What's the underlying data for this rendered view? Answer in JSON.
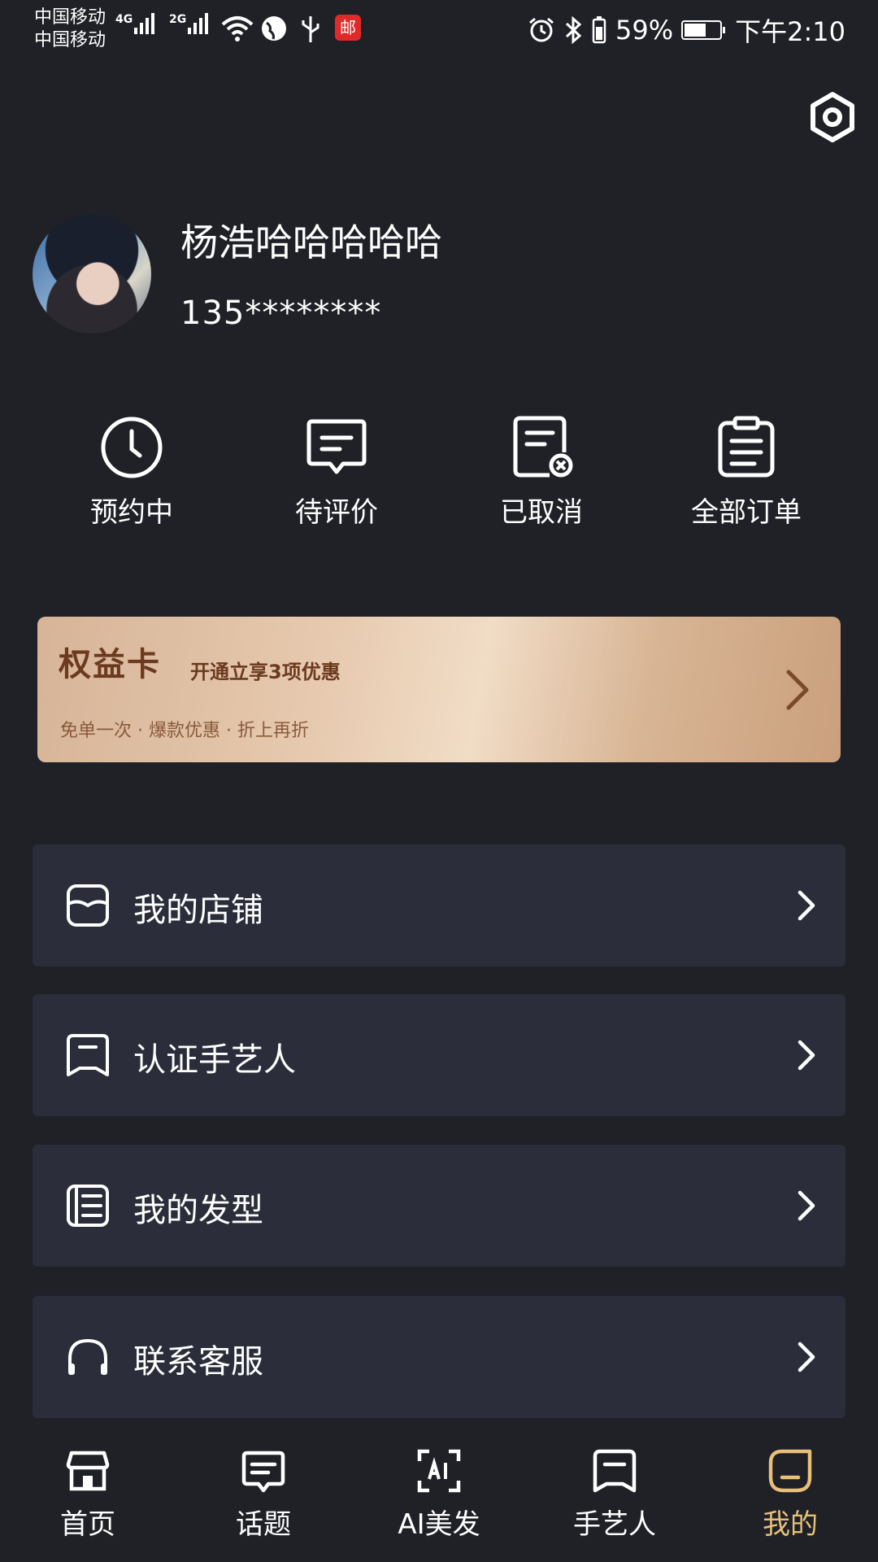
{
  "status_bar": {
    "carrier_1": "中国移动",
    "carrier_2": "中国移动",
    "network_1": "4G",
    "network_2": "2G",
    "battery_percent": "59%",
    "time": "下午2:10",
    "app_badge": "邮"
  },
  "profile": {
    "username": "杨浩哈哈哈哈哈",
    "phone": "135********"
  },
  "orders": [
    {
      "label": "预约中",
      "icon": "clock-icon"
    },
    {
      "label": "待评价",
      "icon": "comment-icon"
    },
    {
      "label": "已取消",
      "icon": "cancelled-doc-icon"
    },
    {
      "label": "全部订单",
      "icon": "clipboard-icon"
    }
  ],
  "vip_card": {
    "title": "权益卡",
    "subtitle": "开通立享3项优惠",
    "description": "免单一次 · 爆款优惠 · 折上再折"
  },
  "menu": [
    {
      "label": "我的店铺",
      "icon": "store-icon"
    },
    {
      "label": "认证手艺人",
      "icon": "badge-icon"
    },
    {
      "label": "我的发型",
      "icon": "hairstyle-icon"
    },
    {
      "label": "联系客服",
      "icon": "headset-icon"
    }
  ],
  "bottom_nav": [
    {
      "label": "首页",
      "icon": "home-store-icon"
    },
    {
      "label": "话题",
      "icon": "topic-icon"
    },
    {
      "label": "AI美发",
      "icon": "ai-scan-icon"
    },
    {
      "label": "手艺人",
      "icon": "craftsman-icon"
    },
    {
      "label": "我的",
      "icon": "profile-icon",
      "active": true
    }
  ],
  "colors": {
    "background": "#1f2127",
    "menu_item_bg": "#2b2e3a",
    "active_tab": "#e8c07a",
    "card_text": "#6b3a1f"
  }
}
